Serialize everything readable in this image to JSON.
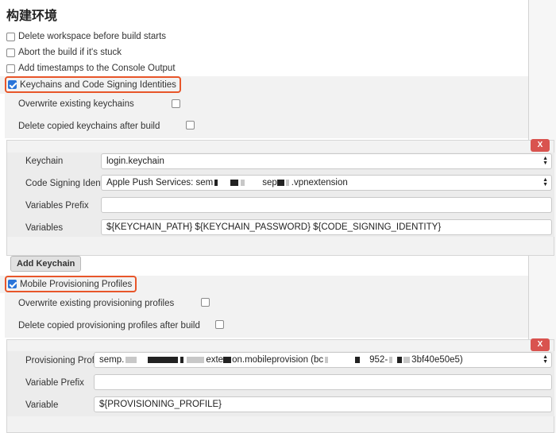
{
  "page": {
    "title": "构建环境"
  },
  "options": {
    "delete_workspace": "Delete workspace before build starts",
    "abort_stuck": "Abort the build if it's stuck",
    "add_timestamps": "Add timestamps to the Console Output",
    "keychains": "Keychains and Code Signing Identities",
    "mobile_provisioning": "Mobile Provisioning Profiles"
  },
  "keychain_section": {
    "overwrite": "Overwrite existing keychains",
    "delete_copied": "Delete copied keychains after build",
    "keychain_label": "Keychain",
    "keychain_value": "login.keychain",
    "identity_label": "Code Signing Identity",
    "identity_prefix": "Apple Push Services: sem",
    "identity_mid": "sep",
    "identity_suffix": ".vpnextension",
    "prefix_label": "Variables Prefix",
    "prefix_value": "",
    "variables_label": "Variables",
    "variables_value": "${KEYCHAIN_PATH} ${KEYCHAIN_PASSWORD} ${CODE_SIGNING_IDENTITY}",
    "delete_button": "X",
    "add_button": "Add Keychain"
  },
  "provisioning_section": {
    "overwrite": "Overwrite existing provisioning profiles",
    "delete_copied": "Delete copied provisioning profiles after build",
    "profile_label": "Provisioning Profile",
    "profile_p1": "semp.",
    "profile_p2": "exte",
    "profile_p3": "on.mobileprovision (bc",
    "profile_p4": "952-",
    "profile_p5": "3bf40e50e5)",
    "prefix_label": "Variable Prefix",
    "prefix_value": "",
    "variable_label": "Variable",
    "variable_value": "${PROVISIONING_PROFILE}",
    "delete_button": "X"
  }
}
